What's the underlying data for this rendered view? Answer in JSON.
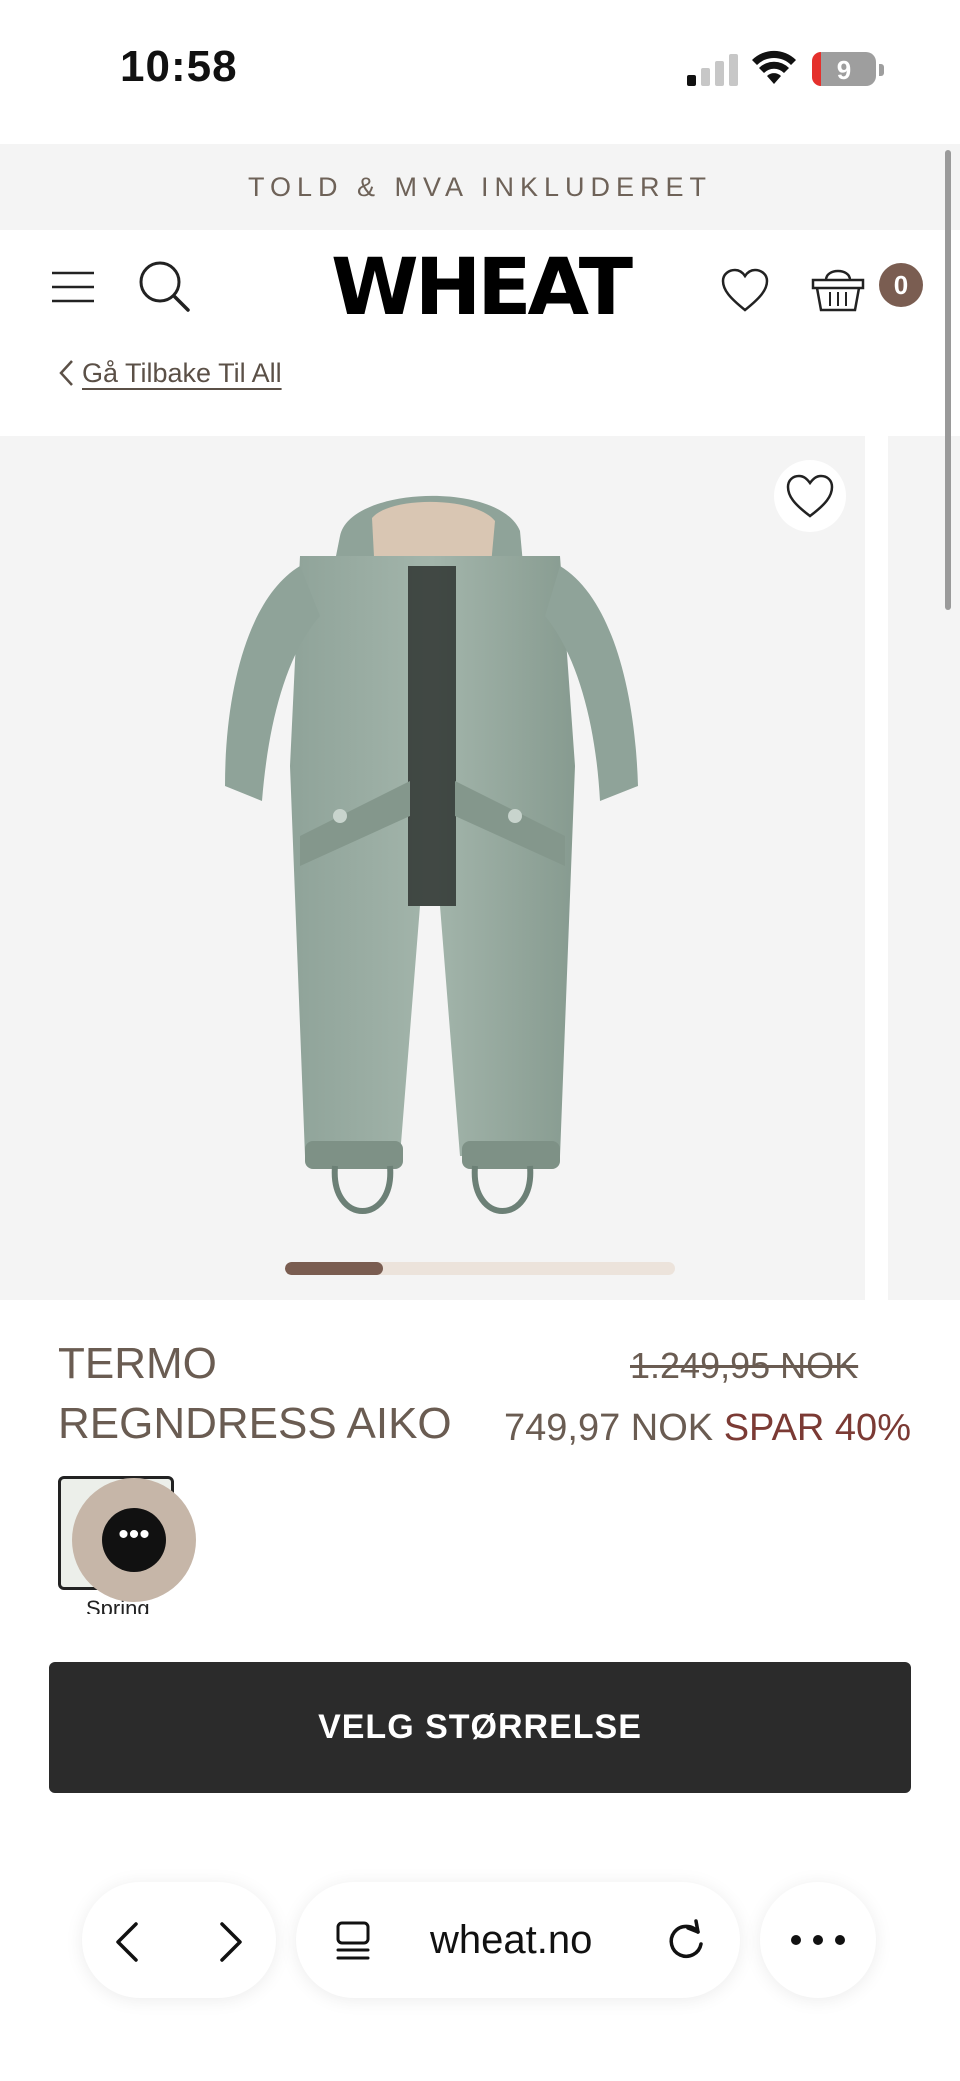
{
  "status_bar": {
    "time": "10:58",
    "battery": "9"
  },
  "announcement": "TOLD & MVA INKLUDERET",
  "header": {
    "logo": "WHEAT",
    "cart_count": "0"
  },
  "breadcrumb": {
    "back_label": "Gå Tilbake Til All"
  },
  "gallery": {
    "image_description": "green rain suit",
    "progress_fraction": 0.25
  },
  "product": {
    "title_line1": "TERMO",
    "title_line2": "REGNDRESS AIKO",
    "old_price": "1.249,95 NOK",
    "new_price": "749,97 NOK",
    "save_label": "SPAR 40%",
    "swatch_label": "Spring"
  },
  "cta_label": "VELG STØRRELSE",
  "browser": {
    "url": "wheat.no"
  },
  "colors": {
    "accent": "#7a5d51",
    "sale": "#7b3a34",
    "text": "#6a5c52",
    "cta_bg": "#2b2b2b"
  }
}
